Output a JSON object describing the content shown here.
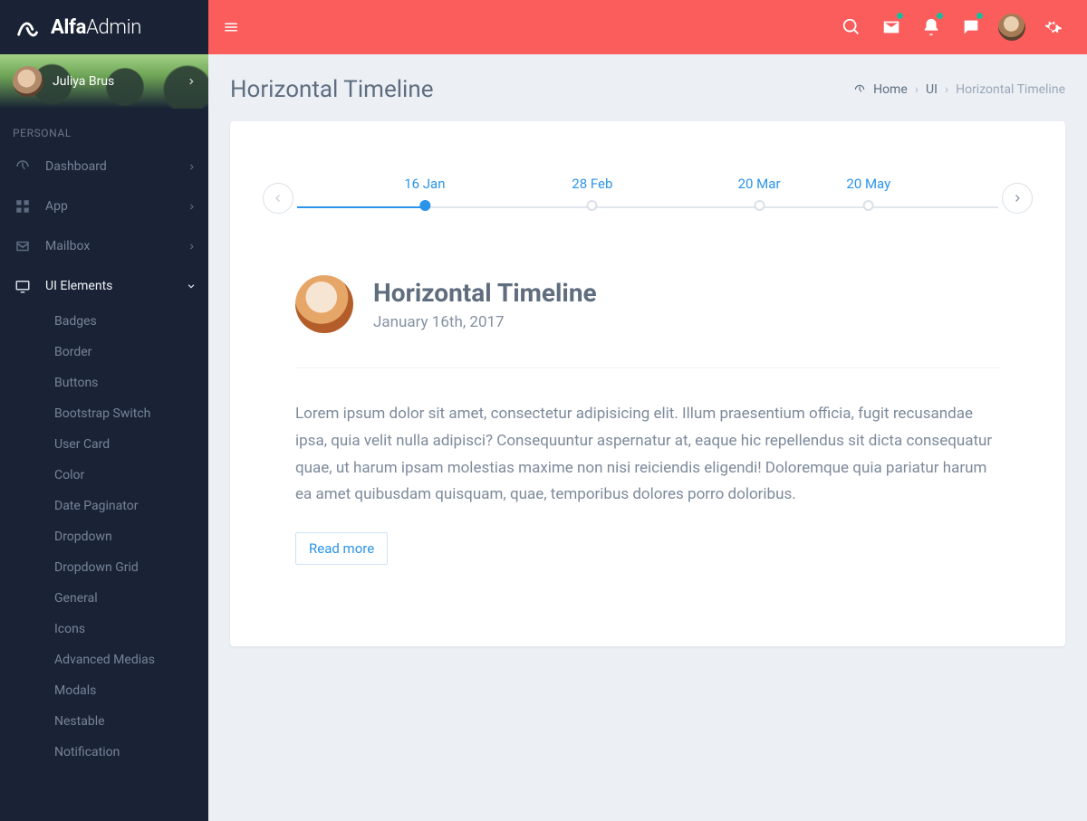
{
  "brand": {
    "bold": "Alfa",
    "light": "Admin"
  },
  "user": {
    "name": "Juliya Brus"
  },
  "sidebar": {
    "section_label": "PERSONAL",
    "items": [
      {
        "label": "Dashboard",
        "icon": "dashboard-icon"
      },
      {
        "label": "App",
        "icon": "apps-icon"
      },
      {
        "label": "Mailbox",
        "icon": "mailbox-icon"
      },
      {
        "label": "UI Elements",
        "icon": "ui-icon"
      }
    ],
    "ui_sub": [
      "Badges",
      "Border",
      "Buttons",
      "Bootstrap Switch",
      "User Card",
      "Color",
      "Date Paginator",
      "Dropdown",
      "Dropdown Grid",
      "General",
      "Icons",
      "Advanced Medias",
      "Modals",
      "Nestable",
      "Notification"
    ]
  },
  "breadcrumb": {
    "home": "Home",
    "ui": "UI",
    "current": "Horizontal Timeline"
  },
  "page": {
    "title": "Horizontal Timeline"
  },
  "chart_data": {
    "type": "timeline",
    "stops": [
      {
        "label": "16 Jan",
        "pos": 18.2,
        "active": true
      },
      {
        "label": "28 Feb",
        "pos": 42.1,
        "active": false
      },
      {
        "label": "20 Mar",
        "pos": 65.9,
        "active": false
      },
      {
        "label": "20 May",
        "pos": 81.5,
        "active": false
      }
    ],
    "active_line_pct": 18.2
  },
  "post": {
    "title": "Horizontal Timeline",
    "date": "January 16th, 2017",
    "body": "Lorem ipsum dolor sit amet, consectetur adipisicing elit. Illum praesentium officia, fugit recusandae ipsa, quia velit nulla adipisci? Consequuntur aspernatur at, eaque hic repellendus sit dicta consequatur quae, ut harum ipsam molestias maxime non nisi reiciendis eligendi! Doloremque quia pariatur harum ea amet quibusdam quisquam, quae, temporibus dolores porro doloribus.",
    "read_more": "Read more"
  }
}
